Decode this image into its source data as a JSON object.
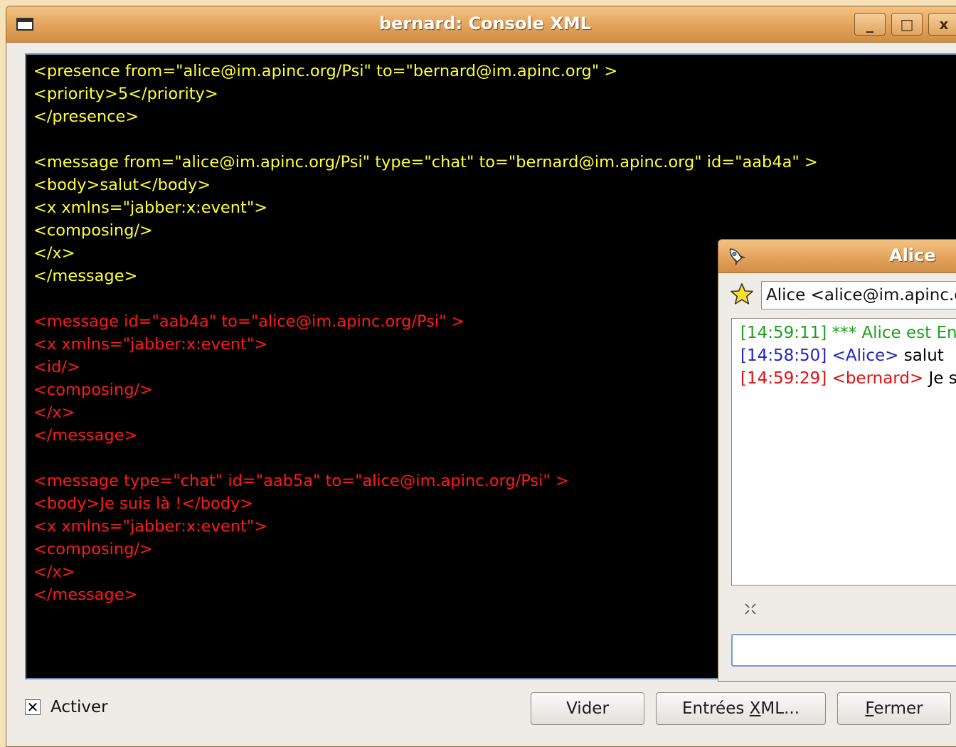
{
  "window": {
    "title": "bernard: Console XML",
    "minimize_glyph": "_",
    "maximize_glyph": "□",
    "close_glyph": "x"
  },
  "console": {
    "lines": [
      {
        "dir": "in",
        "text": "<presence from=\"alice@im.apinc.org/Psi\" to=\"bernard@im.apinc.org\" >"
      },
      {
        "dir": "in",
        "text": "<priority>5</priority>"
      },
      {
        "dir": "in",
        "text": "</presence>"
      },
      {
        "dir": "in",
        "text": ""
      },
      {
        "dir": "in",
        "text": "<message from=\"alice@im.apinc.org/Psi\" type=\"chat\" to=\"bernard@im.apinc.org\" id=\"aab4a\" >"
      },
      {
        "dir": "in",
        "text": "<body>salut</body>"
      },
      {
        "dir": "in",
        "text": "<x xmlns=\"jabber:x:event\">"
      },
      {
        "dir": "in",
        "text": "<composing/>"
      },
      {
        "dir": "in",
        "text": "</x>"
      },
      {
        "dir": "in",
        "text": "</message>"
      },
      {
        "dir": "in",
        "text": ""
      },
      {
        "dir": "out",
        "text": "<message id=\"aab4a\" to=\"alice@im.apinc.org/Psi\" >"
      },
      {
        "dir": "out",
        "text": "<x xmlns=\"jabber:x:event\">"
      },
      {
        "dir": "out",
        "text": "<id/>"
      },
      {
        "dir": "out",
        "text": "<composing/>"
      },
      {
        "dir": "out",
        "text": "</x>"
      },
      {
        "dir": "out",
        "text": "</message>"
      },
      {
        "dir": "out",
        "text": ""
      },
      {
        "dir": "out",
        "text": "<message type=\"chat\" id=\"aab5a\" to=\"alice@im.apinc.org/Psi\" >"
      },
      {
        "dir": "out",
        "text": "<body>Je suis là !</body>"
      },
      {
        "dir": "out",
        "text": "<x xmlns=\"jabber:x:event\">"
      },
      {
        "dir": "out",
        "text": "<composing/>"
      },
      {
        "dir": "out",
        "text": "</x>"
      },
      {
        "dir": "out",
        "text": "</message>"
      }
    ]
  },
  "footer": {
    "enable_checked": true,
    "enable_label": "Activer",
    "clear_label": "Vider",
    "xml_input_label_pre": "Entrées ",
    "xml_input_label_key": "X",
    "xml_input_label_post": "ML...",
    "close_label_key": "F",
    "close_label_post": "ermer"
  },
  "chat": {
    "title": "Alice",
    "contact": "Alice <alice@im.apinc.org/Psi>",
    "messages": [
      {
        "time": "[14:59:11]",
        "sender": "*** Alice est En ligne",
        "text": "",
        "color": "green"
      },
      {
        "time": "[14:58:50]",
        "sender": "<Alice>",
        "text": " salut",
        "color": "blue"
      },
      {
        "time": "[14:59:29]",
        "sender": "<bernard>",
        "text": " Je suis là !",
        "color": "red"
      }
    ],
    "input_value": ""
  },
  "colors": {
    "incoming": "#ffff33",
    "outgoing": "#ff1a1a",
    "titlebar": "#e3a35c",
    "console_bg": "#000000"
  }
}
